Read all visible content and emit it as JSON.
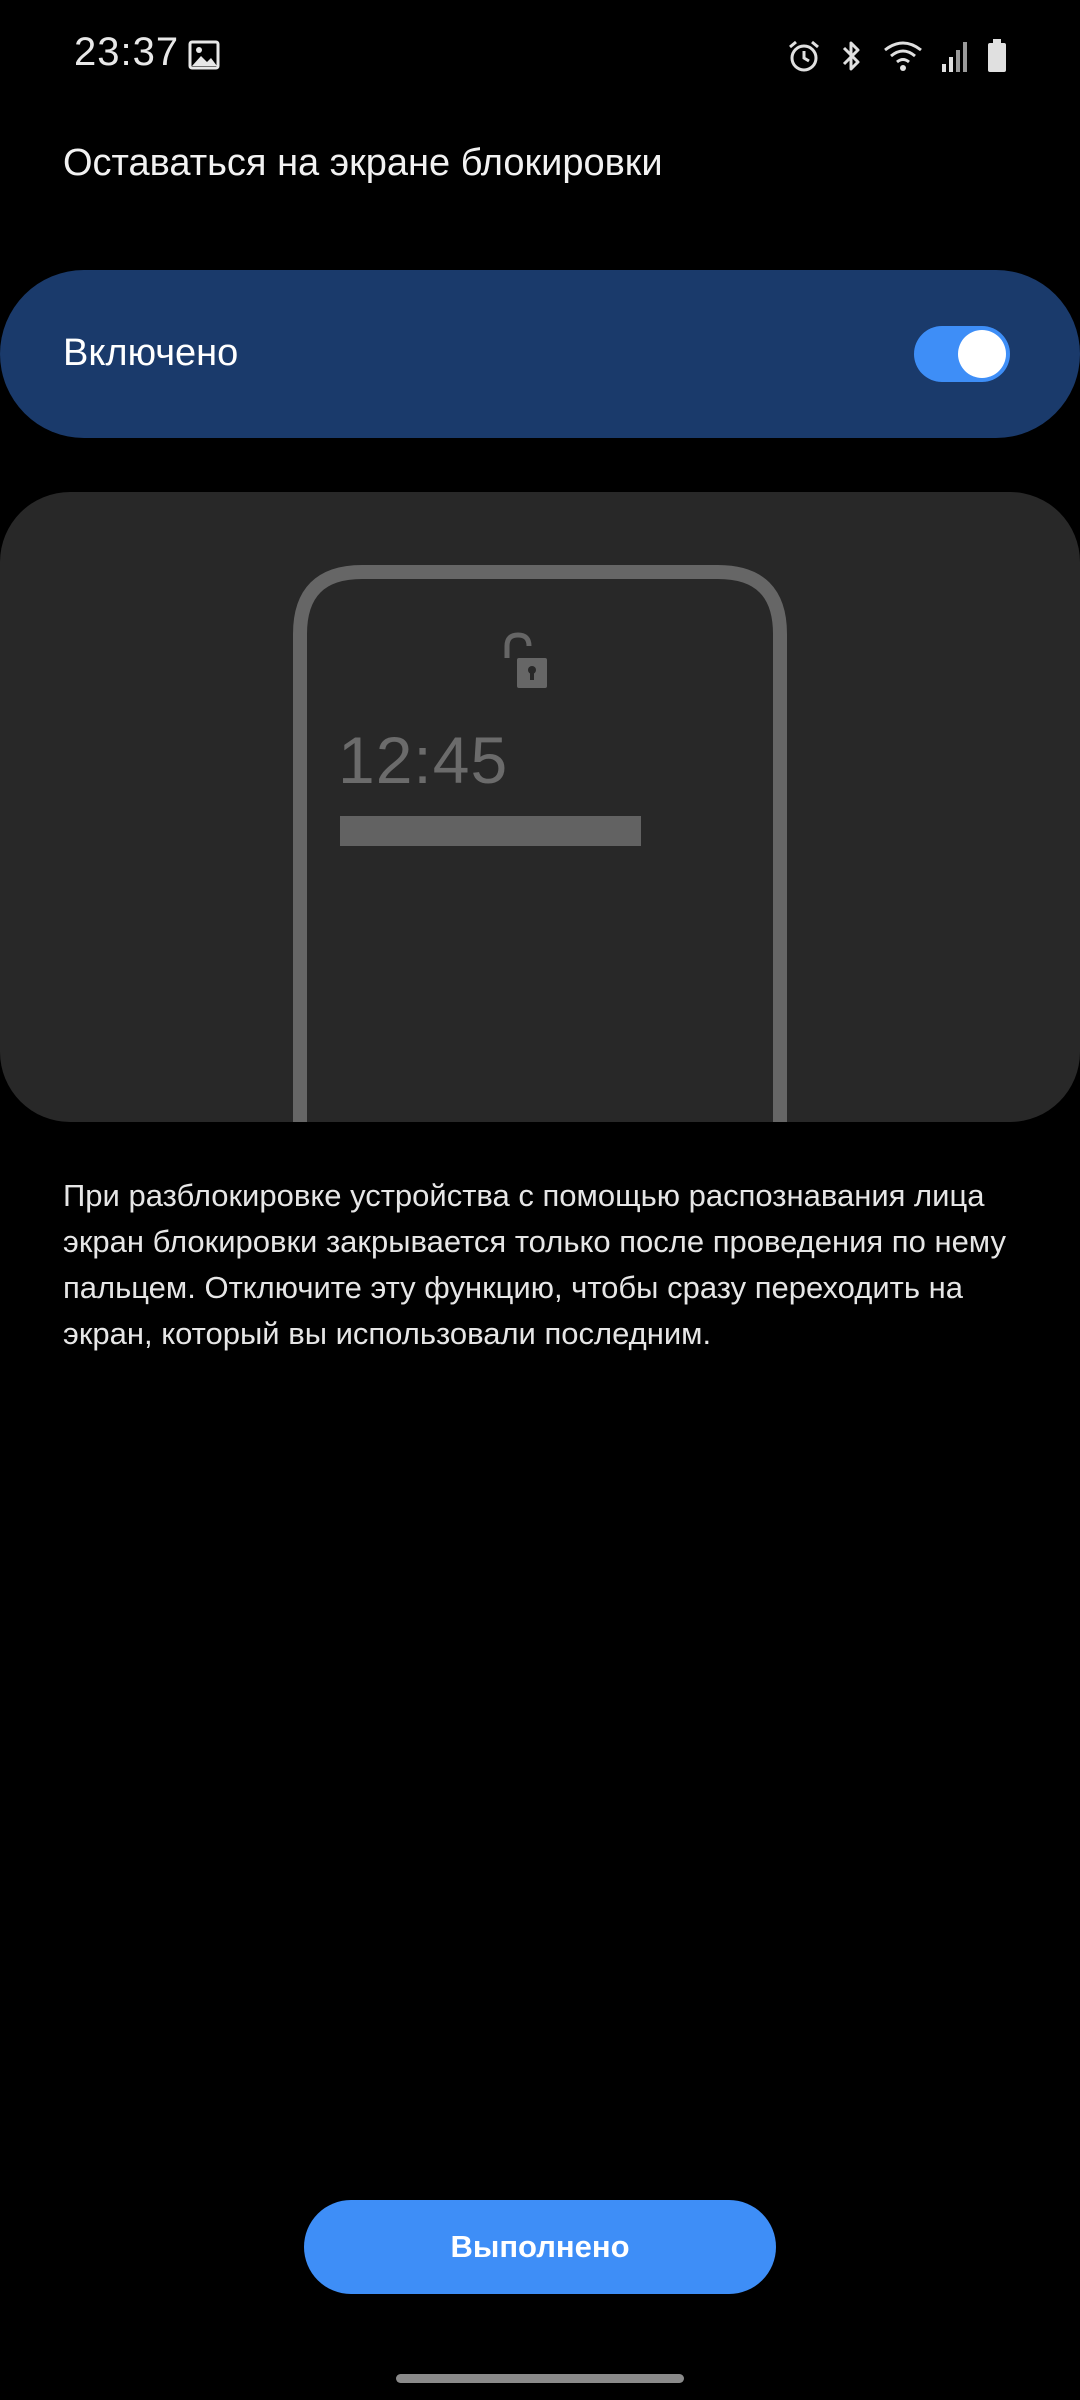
{
  "status_bar": {
    "time": "23:37",
    "icons": [
      "gallery-icon",
      "alarm-icon",
      "bluetooth-icon",
      "wifi-icon",
      "signal-icon",
      "battery-icon"
    ]
  },
  "header": {
    "title": "Оставаться на экране блокировки"
  },
  "toggle": {
    "label": "Включено",
    "state": true,
    "accent_color": "#3e8ef7",
    "row_color": "#1a3a6b"
  },
  "illustration": {
    "time": "12:45",
    "icon": "unlock-icon"
  },
  "description": "При разблокировке устройства с помощью распознавания лица экран блокировки закрывается только после проведения по нему пальцем. Отключите эту функцию, чтобы сразу переходить на экран, который вы использовали последним.",
  "footer": {
    "done_label": "Выполнено"
  }
}
